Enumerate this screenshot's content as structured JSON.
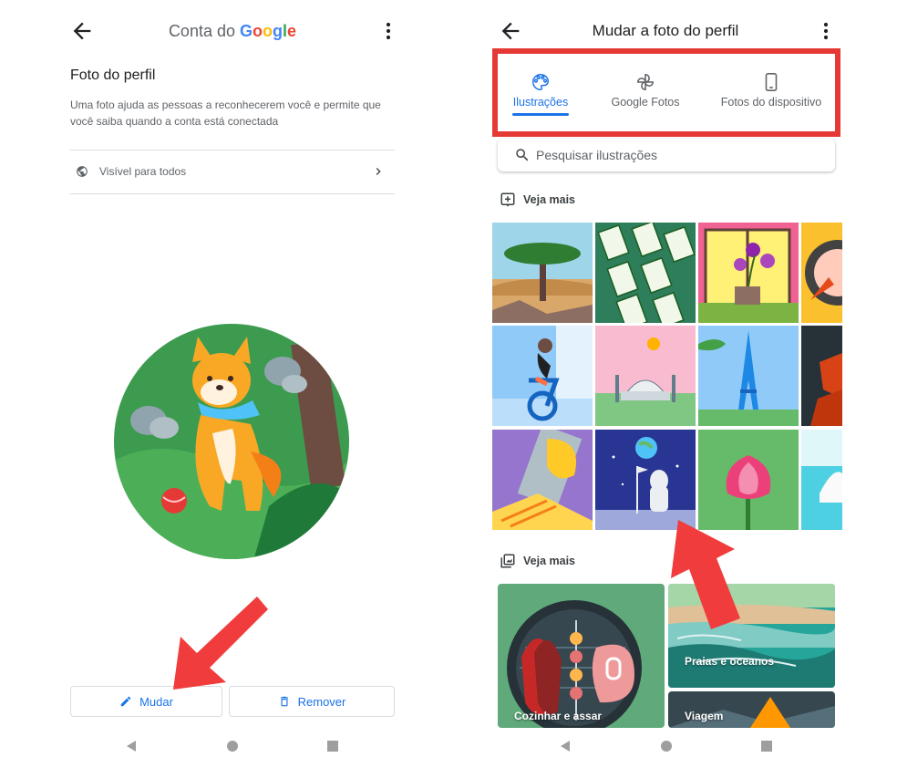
{
  "left_screen": {
    "header": {
      "title_prefix": "Conta do ",
      "title_brand": "Google"
    },
    "section": {
      "title": "Foto do perfil",
      "description": "Uma foto ajuda as pessoas a reconhecerem você e permite que você saiba quando a conta está conectada"
    },
    "visibility": {
      "label": "Visível para todos"
    },
    "buttons": {
      "change": "Mudar",
      "remove": "Remover"
    }
  },
  "right_screen": {
    "header": {
      "title": "Mudar a foto do perfil"
    },
    "tabs": [
      {
        "label": "Ilustrações",
        "icon": "palette-icon",
        "selected": true
      },
      {
        "label": "Google Fotos",
        "icon": "pinwheel-icon",
        "selected": false
      },
      {
        "label": "Fotos do dispositivo",
        "icon": "phone-icon",
        "selected": false
      }
    ],
    "search": {
      "placeholder": "Pesquisar ilustrações"
    },
    "sections": [
      {
        "label": "Veja mais",
        "icon": "add-photo-icon"
      },
      {
        "label": "Veja mais",
        "icon": "collections-icon"
      }
    ],
    "categories": [
      {
        "label": "Cozinhar e assar"
      },
      {
        "label": "Praias e oceanos"
      },
      {
        "label": "Viagem"
      }
    ]
  },
  "colors": {
    "accent": "#1a73e8",
    "highlight_red": "#e53935",
    "google_blue": "#4285f4",
    "google_red": "#ea4335",
    "google_yellow": "#fbbc05",
    "google_green": "#34a853"
  }
}
